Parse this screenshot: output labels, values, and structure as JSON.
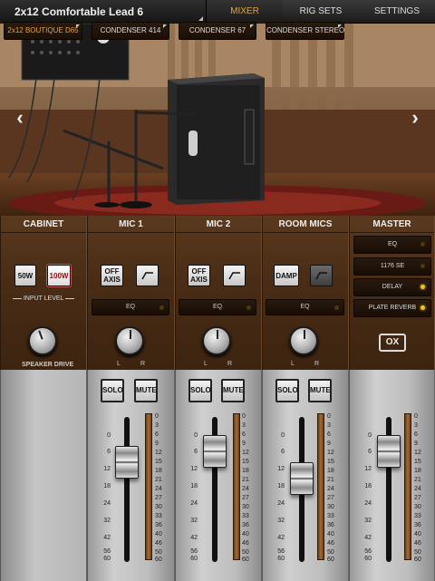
{
  "preset": {
    "name": "2x12 Comfortable Lead 6"
  },
  "nav": {
    "mixer": "MIXER",
    "rig_sets": "RIG SETS",
    "settings": "SETTINGS"
  },
  "colors": {
    "accent": "#e7a23a",
    "panel_wood": "#4a2d16",
    "led_on": "#f2c21a"
  },
  "cabinet": {
    "title": "CABINET",
    "model": "2x12 BOUTIQUE D65",
    "power_50w": "50W",
    "power_100w": "100W",
    "selected_power": "100W",
    "input_level": "INPUT LEVEL",
    "speaker_drive": "SPEAKER DRIVE"
  },
  "mic1": {
    "title": "MIC 1",
    "model": "CONDENSER 414",
    "btn_off_axis": "OFF AXIS",
    "eq": "EQ",
    "l": "L",
    "r": "R"
  },
  "mic2": {
    "title": "MIC 2",
    "model": "CONDENSER 67",
    "btn_off_axis": "OFF AXIS",
    "eq": "EQ",
    "l": "L",
    "r": "R"
  },
  "room": {
    "title": "ROOM MICS",
    "model": "CONDENSER STEREO",
    "btn_damp": "DAMP",
    "eq": "EQ",
    "l": "L",
    "r": "R"
  },
  "master": {
    "title": "MASTER",
    "items": [
      {
        "label": "EQ",
        "on": false
      },
      {
        "label": "1176 SE",
        "on": false
      },
      {
        "label": "DELAY",
        "on": true
      },
      {
        "label": "PLATE REVERB",
        "on": true
      }
    ],
    "ox_button": "OX"
  },
  "faders": {
    "solo": "SOLO",
    "mute": "MUTE",
    "scale_left": [
      "0",
      "6",
      "12",
      "18",
      "24",
      "32",
      "42",
      "56",
      "60"
    ],
    "scale_right": [
      "0",
      "3",
      "6",
      "9",
      "12",
      "15",
      "18",
      "21",
      "24",
      "27",
      "30",
      "33",
      "36",
      "40",
      "46",
      "50",
      "60"
    ]
  }
}
